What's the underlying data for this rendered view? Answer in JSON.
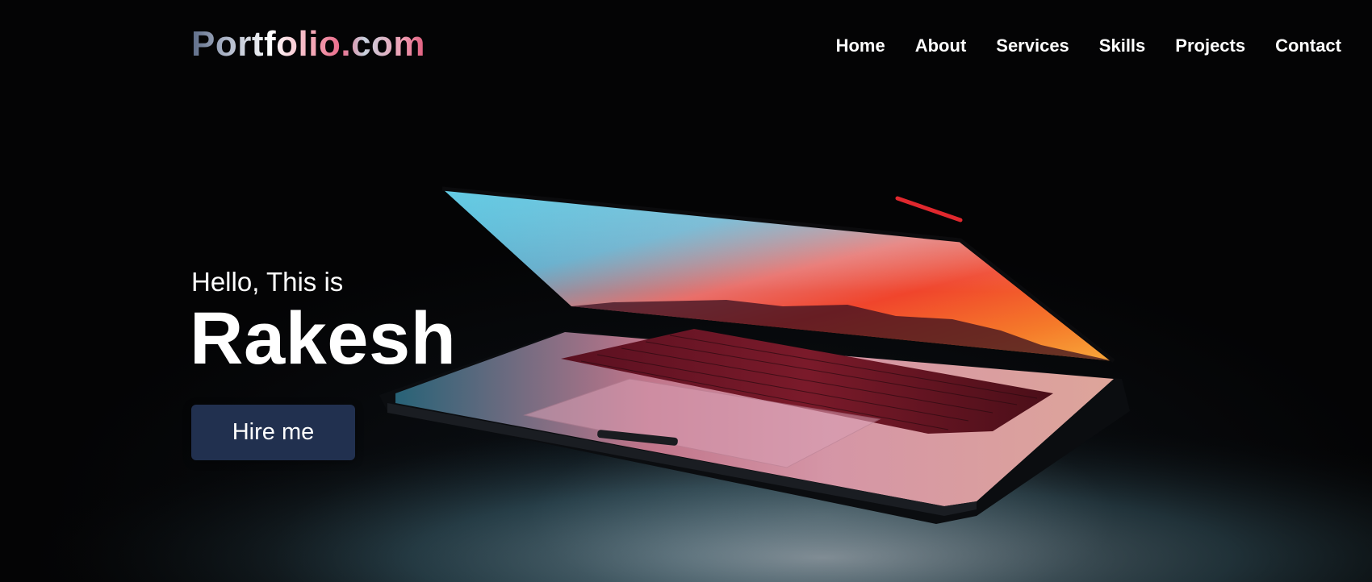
{
  "logo": {
    "text": "Portfolio.com"
  },
  "nav": {
    "items": [
      {
        "label": "Home"
      },
      {
        "label": "About"
      },
      {
        "label": "Services"
      },
      {
        "label": "Skills"
      },
      {
        "label": "Projects"
      },
      {
        "label": "Contact"
      }
    ]
  },
  "hero": {
    "greeting": "Hello, This is",
    "name": "Rakesh",
    "cta_label": "Hire me",
    "background_image": "laptop-glowing-screen",
    "cta_color": "#21304f"
  }
}
